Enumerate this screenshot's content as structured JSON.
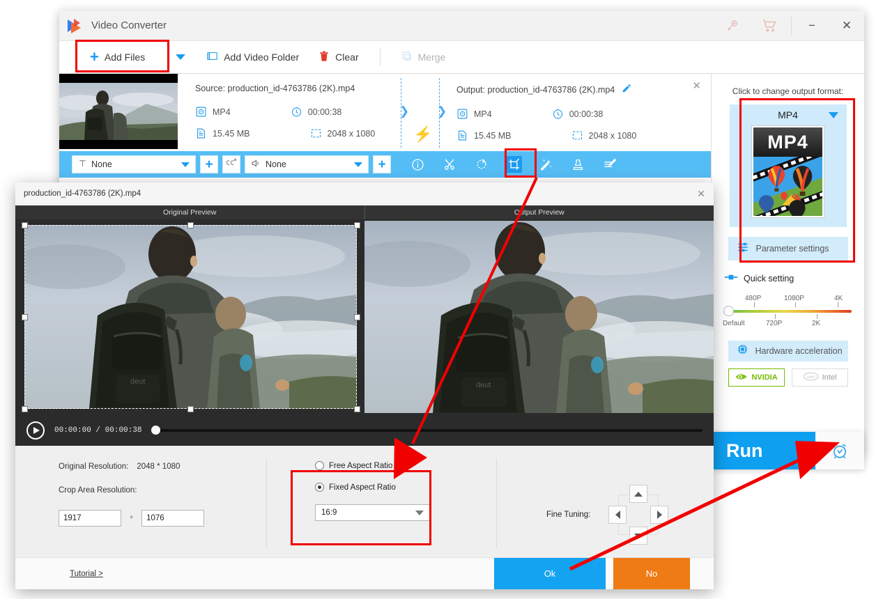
{
  "window": {
    "title": "Video Converter",
    "icons": {
      "key": "key-icon",
      "cart": "cart-icon",
      "minimize": "−",
      "close": "✕"
    }
  },
  "toolbar": {
    "add_files": "Add Files",
    "add_video_folder": "Add Video Folder",
    "clear": "Clear",
    "merge": "Merge"
  },
  "file": {
    "source_label": "Source: production_id-4763786 (2K).mp4",
    "output_label": "Output: production_id-4763786 (2K).mp4",
    "source": {
      "format": "MP4",
      "duration": "00:00:38",
      "size": "15.45 MB",
      "resolution": "2048 x 1080"
    },
    "output": {
      "format": "MP4",
      "duration": "00:00:38",
      "size": "15.45 MB",
      "resolution": "2048 x 1080"
    }
  },
  "editbar": {
    "subtitle_value": "None",
    "audio_value": "None",
    "icons": [
      "info-icon",
      "trim-icon",
      "rotate-icon",
      "crop-icon",
      "effect-icon",
      "watermark-icon",
      "subtitle-edit-icon"
    ]
  },
  "right_panel": {
    "change_format_label": "Click to change output format:",
    "format_name": "MP4",
    "format_thumb_text": "MP4",
    "parameter_settings": "Parameter settings",
    "quick_setting": "Quick setting",
    "slider_top_labels": [
      "480P",
      "1080P",
      "4K"
    ],
    "slider_bottom_labels": [
      "Default",
      "720P",
      "2K"
    ],
    "hardware_acceleration": "Hardware acceleration",
    "gpu_nvidia": "NVIDIA",
    "gpu_intel": "Intel"
  },
  "run": {
    "label": "Run",
    "timer_icon": "alarm-clock-icon"
  },
  "crop_dialog": {
    "title": "production_id-4763786 (2K).mp4",
    "close": "✕",
    "original_preview": "Original Preview",
    "output_preview": "Output Preview",
    "player": {
      "current_time": "00:00:00",
      "separator": "/",
      "total_time": "00:00:38"
    },
    "original_resolution_label": "Original Resolution:",
    "original_resolution_value": "2048 * 1080",
    "crop_area_label": "Crop Area Resolution:",
    "crop_width": "1917",
    "crop_height": "1076",
    "multiply_symbol": "*",
    "free_aspect_ratio": "Free Aspect Ratio",
    "fixed_aspect_ratio": "Fixed Aspect Ratio",
    "aspect_ratio_value": "16:9",
    "fine_tuning_label": "Fine Tuning:",
    "tutorial": "Tutorial >",
    "ok": "Ok",
    "no": "No"
  },
  "colors": {
    "accent_blue": "#13a3f0",
    "editbar_blue": "#55bdf5",
    "highlight_red": "#f10000",
    "orange": "#ee7b16",
    "nvidia_green": "#76b900"
  }
}
